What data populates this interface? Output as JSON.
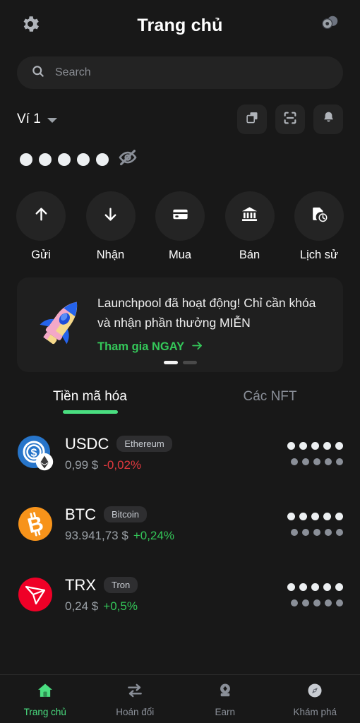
{
  "header": {
    "title": "Trang chủ",
    "left_icon": "gear-icon",
    "right_icon": "coins-icon"
  },
  "search": {
    "placeholder": "Search",
    "icon": "search-icon"
  },
  "wallet": {
    "name": "Ví 1",
    "dropdown_icon": "chevron-down-icon",
    "actions": [
      {
        "name": "copy-icon",
        "label": "copy"
      },
      {
        "name": "scan-icon",
        "label": "scan"
      },
      {
        "name": "bell-icon",
        "label": "notifications"
      }
    ],
    "balance_hidden": true,
    "balance_dot_count": 5,
    "visibility_icon": "eye-off-icon"
  },
  "quick_actions": [
    {
      "label": "Gửi",
      "icon": "arrow-up-icon"
    },
    {
      "label": "Nhận",
      "icon": "arrow-down-icon"
    },
    {
      "label": "Mua",
      "icon": "credit-card-icon"
    },
    {
      "label": "Bán",
      "icon": "bank-icon"
    },
    {
      "label": "Lịch sử",
      "icon": "history-icon"
    }
  ],
  "banner": {
    "icon": "rocket-icon",
    "text": "Launchpool đã hoạt động! Chỉ cần khóa và nhận phần thưởng MIỄN",
    "cta": "Tham gia NGAY",
    "cta_icon": "arrow-right-icon",
    "cta_color": "#34c759",
    "page_count": 2,
    "active_page": 1
  },
  "tabs": [
    {
      "label": "Tiền mã hóa",
      "active": true
    },
    {
      "label": "Các NFT",
      "active": false
    }
  ],
  "tab_accent_color": "#4ade80",
  "tokens": [
    {
      "symbol": "USDC",
      "network": "Ethereum",
      "price": "0,99 $",
      "change": "-0,02%",
      "change_direction": "down",
      "icon": "usdc-icon",
      "icon_color": "#2775CA",
      "badge_icon": "ethereum-icon",
      "amount_hidden": true,
      "value_hidden": true,
      "hidden_dot_count": 5
    },
    {
      "symbol": "BTC",
      "network": "Bitcoin",
      "price": "93.941,73 $",
      "change": "+0,24%",
      "change_direction": "up",
      "icon": "bitcoin-icon",
      "icon_color": "#F7931A",
      "amount_hidden": true,
      "value_hidden": true,
      "hidden_dot_count": 5
    },
    {
      "symbol": "TRX",
      "network": "Tron",
      "price": "0,24 $",
      "change": "+0,5%",
      "change_direction": "up",
      "icon": "tron-icon",
      "icon_color": "#EF0027",
      "amount_hidden": true,
      "value_hidden": true,
      "hidden_dot_count": 5
    }
  ],
  "bottom_nav": [
    {
      "label": "Trang chủ",
      "icon": "home-icon",
      "active": true
    },
    {
      "label": "Hoán đổi",
      "icon": "swap-icon",
      "active": false
    },
    {
      "label": "Earn",
      "icon": "earn-icon",
      "active": false
    },
    {
      "label": "Khám phá",
      "icon": "compass-icon",
      "active": false
    }
  ],
  "colors": {
    "background": "#181818",
    "surface": "#232323",
    "accent_green": "#4ade80",
    "positive": "#34c759",
    "negative": "#e0383e",
    "text_muted": "#8a8f98"
  }
}
